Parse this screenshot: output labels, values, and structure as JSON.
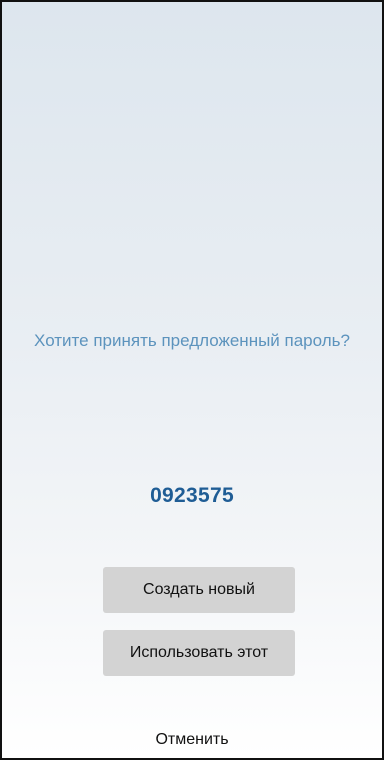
{
  "dialog": {
    "prompt": "Хотите принять предложенный пароль?",
    "password": "0923575",
    "create_new_label": "Создать новый",
    "use_this_label": "Использовать этот",
    "cancel_label": "Отменить"
  },
  "colors": {
    "prompt_text": "#5c93bd",
    "password_text": "#1f5d95",
    "button_bg": "#d3d3d3"
  }
}
